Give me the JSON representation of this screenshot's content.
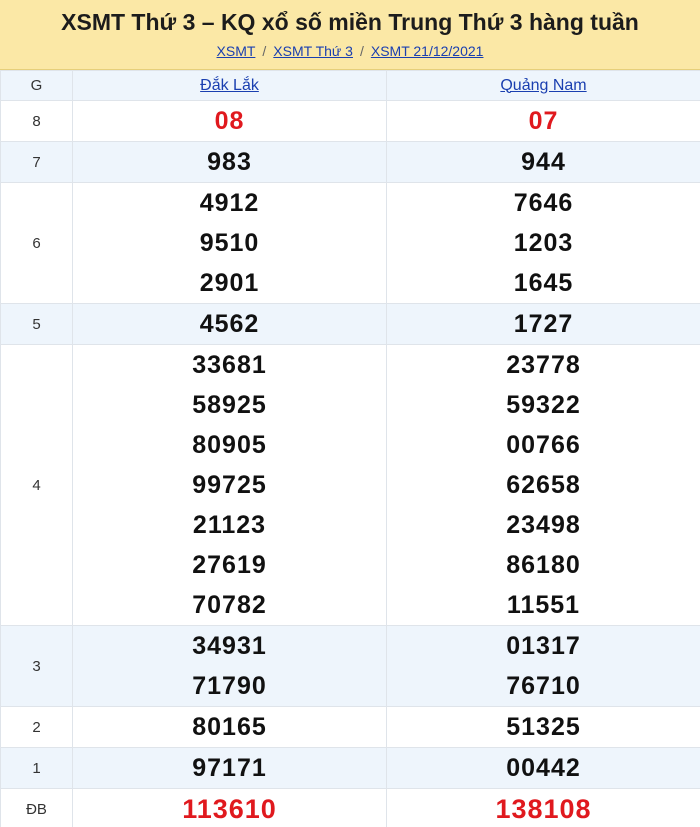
{
  "header": {
    "title": "XSMT Thứ 3 – KQ xổ số miền Trung Thứ 3 hàng tuần",
    "breadcrumb": [
      "XSMT",
      "XSMT Thứ 3",
      "XSMT 21/12/2021"
    ],
    "separator": "/"
  },
  "table": {
    "col_label": "G",
    "provinces": [
      "Đắk Lắk",
      "Quảng Nam"
    ],
    "rows": {
      "g8": {
        "label": "8",
        "p1": [
          "08"
        ],
        "p2": [
          "07"
        ]
      },
      "g7": {
        "label": "7",
        "p1": [
          "983"
        ],
        "p2": [
          "944"
        ]
      },
      "g6": {
        "label": "6",
        "p1": [
          "4912",
          "9510",
          "2901"
        ],
        "p2": [
          "7646",
          "1203",
          "1645"
        ]
      },
      "g5": {
        "label": "5",
        "p1": [
          "4562"
        ],
        "p2": [
          "1727"
        ]
      },
      "g4": {
        "label": "4",
        "p1": [
          "33681",
          "58925",
          "80905",
          "99725",
          "21123",
          "27619",
          "70782"
        ],
        "p2": [
          "23778",
          "59322",
          "00766",
          "62658",
          "23498",
          "86180",
          "11551"
        ]
      },
      "g3": {
        "label": "3",
        "p1": [
          "34931",
          "71790"
        ],
        "p2": [
          "01317",
          "76710"
        ]
      },
      "g2": {
        "label": "2",
        "p1": [
          "80165"
        ],
        "p2": [
          "51325"
        ]
      },
      "g1": {
        "label": "1",
        "p1": [
          "97171"
        ],
        "p2": [
          "00442"
        ]
      },
      "db": {
        "label": "ĐB",
        "p1": [
          "113610"
        ],
        "p2": [
          "138108"
        ]
      }
    }
  },
  "colors": {
    "header_bg": "#fbe8a6",
    "alt_row_bg": "#eef5fc",
    "link": "#1a3fb0",
    "highlight_number": "#e0191e"
  }
}
